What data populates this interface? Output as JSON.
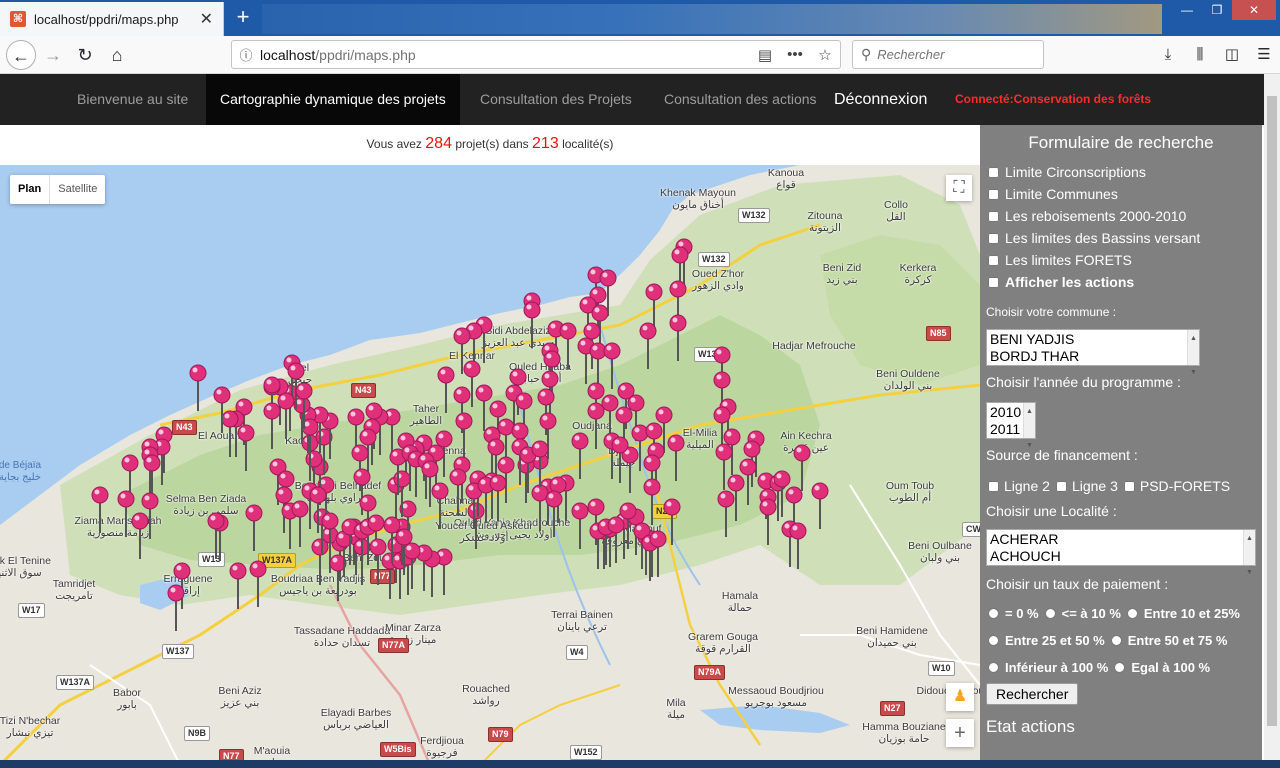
{
  "browser": {
    "tab_title": "localhost/ppdri/maps.php",
    "url": "localhost/ppdri/maps.php",
    "url_host": "localhost",
    "url_path": "/ppdri/maps.php",
    "search_placeholder": "Rechercher"
  },
  "nav": {
    "items": [
      "Bienvenue au site",
      "Cartographie dynamique des projets",
      "Consultation des Projets",
      "Consultation des actions"
    ],
    "active_index": 1,
    "logout": "Déconnexion",
    "connected": "Connecté:Conservation des forêts"
  },
  "summary": {
    "prefix": "Vous avez",
    "projects": "284",
    "middle": "projet(s) dans",
    "localities": "213",
    "suffix": "localité(s)"
  },
  "map": {
    "type_plan": "Plan",
    "type_satellite": "Satellite",
    "selected_type": "Plan",
    "marker_color": "#e0307a",
    "labels": [
      {
        "t": "Kanoua",
        "a": "قواع"
      },
      {
        "t": "Khenak Mayoun",
        "a": "أخناق مايون"
      },
      {
        "t": "Collo",
        "a": "القل"
      },
      {
        "t": "Zitouna",
        "a": "الزيتونة"
      },
      {
        "t": "Oued Z'hor",
        "a": "وادي الزهور"
      },
      {
        "t": "Beni Zid",
        "a": "بني زيد"
      },
      {
        "t": "Kerkera",
        "a": "كركرة"
      },
      {
        "t": "Sidi Abdelaziz",
        "a": "سيدي عبد العزيز"
      },
      {
        "t": "Hadjar Mefrouche",
        "a": ""
      },
      {
        "t": "Jijel",
        "a": "جيجل"
      },
      {
        "t": "El Kennar",
        "a": ""
      },
      {
        "t": "Taher",
        "a": "الطاهير"
      },
      {
        "t": "El-Milia",
        "a": "الميلية"
      },
      {
        "t": "Ouled Hbaba",
        "a": "أولاد حبابة"
      },
      {
        "t": "Ain Kechra",
        "a": "عين قشرة"
      },
      {
        "t": "El Aouana",
        "a": ""
      },
      {
        "t": "Kaous",
        "a": ""
      },
      {
        "t": "Beni Ouldene",
        "a": "بني الولدان"
      },
      {
        "t": "Selma Ben Ziada",
        "a": "سلمى بن زيادة"
      },
      {
        "t": "Chahna",
        "a": "الشحنة"
      },
      {
        "t": "Ouled Yahia Khadrouche",
        "a": "أولاد يحيى خدروش"
      },
      {
        "t": "Oum Toub",
        "a": "أم الطوب"
      },
      {
        "t": "Ziama Mansouriah",
        "a": "زيامة منصورية"
      },
      {
        "t": "Texenna",
        "a": ""
      },
      {
        "t": "Djimla",
        "a": "جيملة"
      },
      {
        "t": "Oudjana",
        "a": ""
      },
      {
        "t": "Bouraoui Belhadef",
        "a": "بوراوي بلهادف"
      },
      {
        "t": "Sidi Maarouf",
        "a": "سيدي معروف"
      },
      {
        "t": "Erraguene",
        "a": "إراقن"
      },
      {
        "t": "Boudriaa Ben Yadjis",
        "a": "بودريعة بن ياجيس"
      },
      {
        "t": "Youcef Ouled Askeur",
        "a": "أولاد عسكر"
      },
      {
        "t": "Beni Oulbane",
        "a": "بني ولبان"
      },
      {
        "t": "Tamridjet",
        "a": "تامريجت"
      },
      {
        "t": "Souk El Tenine",
        "a": "سوق الاثنين"
      },
      {
        "t": "Beni Zoudi",
        "a": ""
      },
      {
        "t": "Tassadane Haddada",
        "a": "تسدان حدادة"
      },
      {
        "t": "Minar Zarza",
        "a": "مينار زارزة"
      },
      {
        "t": "Terrai Bainen",
        "a": "ترعي باينان"
      },
      {
        "t": "Hamala",
        "a": "حمالة"
      },
      {
        "t": "Grarem Gouga",
        "a": "القرارم قوقة"
      },
      {
        "t": "Beni Hamidene",
        "a": "بني حميدان"
      },
      {
        "t": "Babor",
        "a": "بابور"
      },
      {
        "t": "Beni Aziz",
        "a": "بني عزيز"
      },
      {
        "t": "Rouached",
        "a": "رواشد"
      },
      {
        "t": "Mila",
        "a": "ميلة"
      },
      {
        "t": "Messaoud Boudjriou",
        "a": "مسعود بوجريو"
      },
      {
        "t": "Tizi N'bechar",
        "a": "تيزي نبشار"
      },
      {
        "t": "Elayadi Barbes",
        "a": "العياضي برباس"
      },
      {
        "t": "Ferdjioua",
        "a": "فرجيوة"
      },
      {
        "t": "Hamma Bouziane",
        "a": "حامة بوزيان"
      },
      {
        "t": "M'aouia",
        "a": "معاوية"
      },
      {
        "t": "de Béjaïa",
        "a": "خليج بجاية"
      },
      {
        "t": "Didouche Mourad",
        "a": ""
      }
    ],
    "roads": [
      "W132",
      "W132",
      "N85",
      "W13",
      "N43",
      "N43",
      "W13",
      "N27",
      "W137A",
      "N77",
      "N77A",
      "W17",
      "W137",
      "W137A",
      "W4",
      "N79A",
      "W10",
      "N27",
      "N9B",
      "N77",
      "W5Bis",
      "N79",
      "W152",
      "CW7"
    ]
  },
  "form": {
    "title": "Formulaire de recherche",
    "layers": [
      {
        "label": "Limite Circonscriptions",
        "checked": false
      },
      {
        "label": "Limite Communes",
        "checked": false
      },
      {
        "label": "Les reboisements 2000-2010",
        "checked": false
      },
      {
        "label": "Les limites des Bassins versant",
        "checked": false
      },
      {
        "label": "Les limites FORETS",
        "checked": false
      },
      {
        "label": "Afficher les actions",
        "checked": false
      }
    ],
    "commune_label": "Choisir votre commune :",
    "communes": [
      "BENI YADJIS",
      "BORDJ THAR"
    ],
    "year_label": "Choisir l'année du programme :",
    "years": [
      "2010",
      "2011"
    ],
    "funding_label": "Source de financement :",
    "funding": [
      "Ligne 2",
      "Ligne 3",
      "PSD-FORETS"
    ],
    "locality_label": "Choisir une Localité :",
    "localities": [
      "ACHERAR",
      "ACHOUCH"
    ],
    "rate_label": "Choisir un taux de paiement :",
    "rates": [
      "= 0 %",
      "<= à 10 %",
      "Entre 10 et 25%",
      "Entre 25 et 50 %",
      "Entre 50 et 75 %",
      "Inférieur à 100 %",
      "Egal à 100 %"
    ],
    "search_button": "Rechercher",
    "state_title": "Etat actions"
  }
}
